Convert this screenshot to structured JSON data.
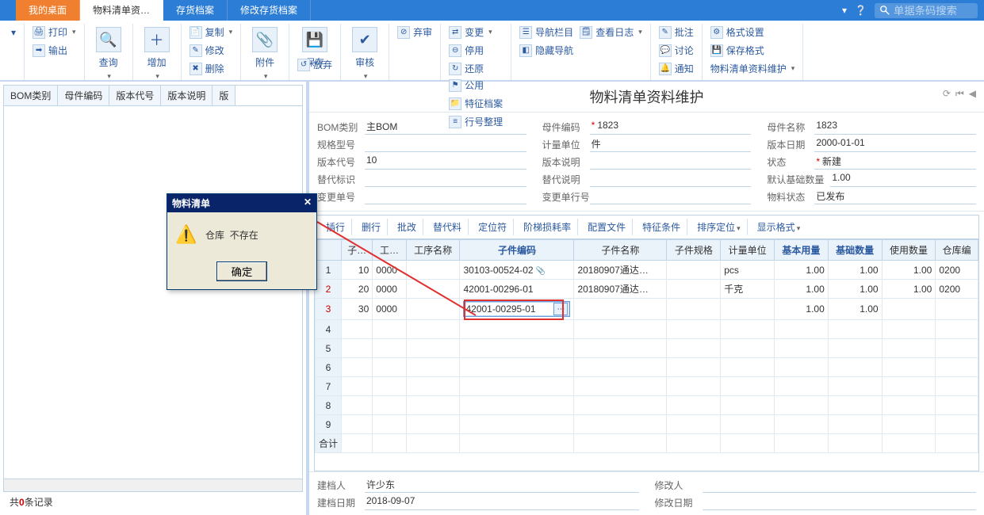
{
  "tabs": {
    "home": "我的桌面",
    "active": "物料清单资…",
    "t2": "存货档案",
    "t3": "修改存货档案"
  },
  "search": {
    "placeholder": "单据条码搜索"
  },
  "ribbon": {
    "print": "打印",
    "export": "输出",
    "query": "查询",
    "add": "增加",
    "copy": "复制",
    "modify": "修改",
    "delete": "删除",
    "attach": "附件",
    "save": "保存",
    "discard": "放弃",
    "audit": "审核",
    "unaudit": "弃审",
    "change": "变更",
    "disable": "停用",
    "restore": "还原",
    "public": "公用",
    "featfile": "特征档案",
    "linearr": "行号整理",
    "navbar": "导航栏目",
    "viewlog": "查看日志",
    "hidenav": "隐藏导航",
    "batchapprove": "批注",
    "discuss": "讨论",
    "notify": "通知",
    "fmtset": "格式设置",
    "savefmt": "保存格式",
    "pagename": "物料清单资料维护"
  },
  "left_headers": [
    "BOM类别",
    "母件编码",
    "版本代号",
    "版本说明",
    "版"
  ],
  "left_status_prefix": "共",
  "left_status_count": "0",
  "left_status_suffix": "条记录",
  "dialog": {
    "title": "物料清单",
    "msg1": "仓库",
    "msg2": "不存在",
    "ok": "确定"
  },
  "page_title": "物料清单资料维护",
  "form": {
    "bom_type_label": "BOM类别",
    "bom_type_value": "主BOM",
    "parent_code_label": "母件编码",
    "parent_code_value": "1823",
    "parent_name_label": "母件名称",
    "parent_name_value": "1823",
    "spec_label": "规格型号",
    "spec_value": "",
    "uom_label": "计量单位",
    "uom_value": "件",
    "ver_date_label": "版本日期",
    "ver_date_value": "2000-01-01",
    "ver_code_label": "版本代号",
    "ver_code_value": "10",
    "ver_note_label": "版本说明",
    "ver_note_value": "",
    "status_label": "状态",
    "status_value": "新建",
    "alt_flag_label": "替代标识",
    "alt_flag_value": "",
    "alt_note_label": "替代说明",
    "alt_note_value": "",
    "default_base_label": "默认基础数量",
    "default_base_value": "1.00",
    "change_no_label": "变更单号",
    "change_no_value": "",
    "change_line_label": "变更单行号",
    "change_line_value": "",
    "mat_status_label": "物料状态",
    "mat_status_value": "已发布"
  },
  "grid_toolbar": [
    "插行",
    "删行",
    "批改",
    "替代料",
    "定位符",
    "阶梯损耗率",
    "配置文件",
    "特征条件",
    "排序定位",
    "显示格式"
  ],
  "grid_cols": [
    "",
    "子…",
    "工…",
    "工序名称",
    "子件编码",
    "子件名称",
    "子件规格",
    "计量单位",
    "基本用量",
    "基础数量",
    "使用数量",
    "仓库编"
  ],
  "grid_rows": [
    {
      "n": "1",
      "seq": "10",
      "op": "0000",
      "opname": "",
      "child_code": "30103-00524-02",
      "clip": true,
      "child_name": "20180907通达…",
      "spec": "",
      "uom": "pcs",
      "base_use": "1.00",
      "base_qty": "1.00",
      "use_qty": "1.00",
      "wh": "0200"
    },
    {
      "n": "2",
      "seq": "20",
      "op": "0000",
      "opname": "",
      "child_code": "42001-00296-01",
      "clip": false,
      "child_name": "20180907通达…",
      "spec": "",
      "uom": "千克",
      "base_use": "1.00",
      "base_qty": "1.00",
      "use_qty": "1.00",
      "wh": "0200"
    },
    {
      "n": "3",
      "seq": "30",
      "op": "0000",
      "opname": "",
      "child_code": "42001-00295-01",
      "clip": false,
      "pick": true,
      "child_name": "",
      "spec": "",
      "uom": "",
      "base_use": "1.00",
      "base_qty": "1.00",
      "use_qty": "",
      "wh": ""
    }
  ],
  "grid_sum": "合计",
  "footer": {
    "creator_label": "建档人",
    "creator_value": "许少东",
    "modifier_label": "修改人",
    "modifier_value": "",
    "create_date_label": "建档日期",
    "create_date_value": "2018-09-07",
    "modify_date_label": "修改日期",
    "modify_date_value": ""
  }
}
